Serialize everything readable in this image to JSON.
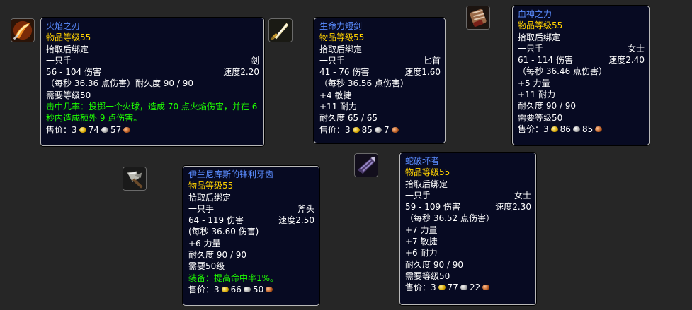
{
  "items": [
    {
      "icon": "flame-blade-icon",
      "name": "火焰之刃",
      "ilvl": "物品等级55",
      "bind": "拾取后绑定",
      "slot": "一只手",
      "type": "剑",
      "damage": "56 - 104 伤害",
      "speed": "速度2.20",
      "dps": "（每秒 36.36 点伤害）耐久度 90 / 90",
      "require": "需要等级50",
      "effect": "击中几率：投掷一个火球，造成 70 点火焰伤害，并在 6 秒内造成额外 9 点伤害。",
      "price_label": "售价：",
      "gold": "3",
      "silver": "74",
      "copper": "57"
    },
    {
      "icon": "short-sword-icon",
      "name": "生命力短剑",
      "ilvl": "物品等级55",
      "bind": "拾取后绑定",
      "slot": "一只手",
      "type": "匕首",
      "damage": "41 - 76 伤害",
      "speed": "速度1.60",
      "dps": "（每秒 36.56 点伤害）",
      "stats": [
        "+4 敏捷",
        "+11 耐力"
      ],
      "durability": "耐久度 65 / 65",
      "price_label": "售价：",
      "gold": "3",
      "silver": "85",
      "copper": "7"
    },
    {
      "icon": "fist-weapon-icon",
      "name": "血神之力",
      "ilvl": "物品等级55",
      "bind": "拾取后绑定",
      "slot": "一只手",
      "type": "女士",
      "damage": "61 - 114 伤害",
      "speed": "速度2.40",
      "dps": "（每秒 36.46 点伤害）",
      "stats": [
        "+5 力量",
        "+11 耐力"
      ],
      "durability": "耐久度 90 / 90",
      "require": "需要等级50",
      "price_label": "售价：",
      "gold": "3",
      "silver": "86",
      "copper": "85"
    },
    {
      "icon": "axe-icon",
      "name": "伊兰尼库斯的锋利牙齿",
      "ilvl": "物品等级55",
      "bind": "拾取后绑定",
      "slot": "一只手",
      "type": "斧头",
      "damage": "64 - 119 伤害",
      "speed": "速度2.50",
      "dps": "(每秒 36.60 伤害)",
      "stats": [
        "+6 力量"
      ],
      "durability": "耐久度 90 / 90",
      "require": "需要50级",
      "effect": "装备：提高命中率1%。",
      "price_label": "售价：",
      "gold": "3",
      "silver": "66",
      "copper": "50"
    },
    {
      "icon": "serpent-fist-icon",
      "name": "蛇破坏者",
      "ilvl": "物品等级55",
      "bind": "拾取后绑定",
      "slot": "一只手",
      "type": "女士",
      "damage": "59 - 109 伤害",
      "speed": "速度2.30",
      "dps": "（每秒 36.52 点伤害）",
      "stats": [
        "+7 力量",
        "+7 敏捷",
        "+6 耐力"
      ],
      "durability": "耐久度 90 / 90",
      "require": "需要等级50",
      "price_label": "售价：",
      "gold": "3",
      "silver": "77",
      "copper": "22"
    }
  ]
}
